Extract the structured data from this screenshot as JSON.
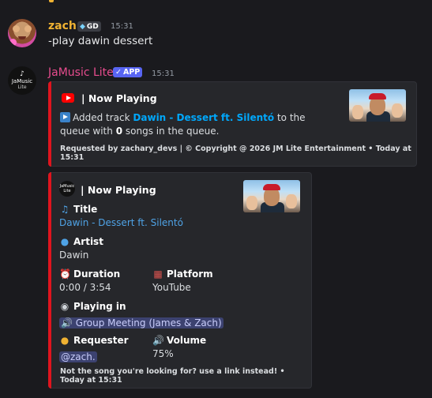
{
  "message1": {
    "username": "zach.",
    "tag": "GD",
    "timestamp": "15:31",
    "text": "-play dawin dessert"
  },
  "message2": {
    "username": "JaMusic Lite",
    "app_badge": "APP",
    "timestamp": "15:31",
    "avatar_line1": "JaMusic",
    "avatar_line2": "Lite"
  },
  "embed1": {
    "title": "| Now Playing",
    "desc_prefix": "Added track",
    "track_link": "Dawin - Dessert ft. Silentó",
    "desc_middle": "to the queue with",
    "queue_count": "0",
    "desc_suffix": "songs in the queue.",
    "footer": "Requested by zachary_devs | © Copyright @ 2026 JM Lite Entertainment • Today at 15:31"
  },
  "embed2": {
    "title": "| Now Playing",
    "mini_line1": "JaMusic",
    "mini_line2": "Lite",
    "fields": {
      "title_label": "Title",
      "title_value": "Dawin - Dessert ft. Silentó",
      "artist_label": "Artist",
      "artist_value": "Dawin",
      "duration_label": "Duration",
      "duration_value": "0:00 / 3:54",
      "platform_label": "Platform",
      "platform_value": "YouTube",
      "playing_in_label": "Playing in",
      "playing_in_value": "Group Meeting (James & Zach)",
      "requester_label": "Requester",
      "requester_value": "@zach.",
      "volume_label": "Volume",
      "volume_value": "75%"
    },
    "footer": "Not the song you're looking for? use a link instead! • Today at 15:31"
  },
  "colors": {
    "background": "#1a1a1e",
    "embed_bg": "#26272b",
    "embed_accent": "#e0141e",
    "username_zach": "#f0b232",
    "username_bot": "#e74c8e",
    "link": "#00a8fc",
    "app_badge": "#5865f2"
  },
  "icons": [
    "youtube-icon",
    "play-icon",
    "music-notes-icon",
    "person-icon",
    "alarm-clock-icon",
    "books-icon",
    "disc-icon",
    "speaker-icon",
    "ear-icon",
    "volume-icon"
  ]
}
